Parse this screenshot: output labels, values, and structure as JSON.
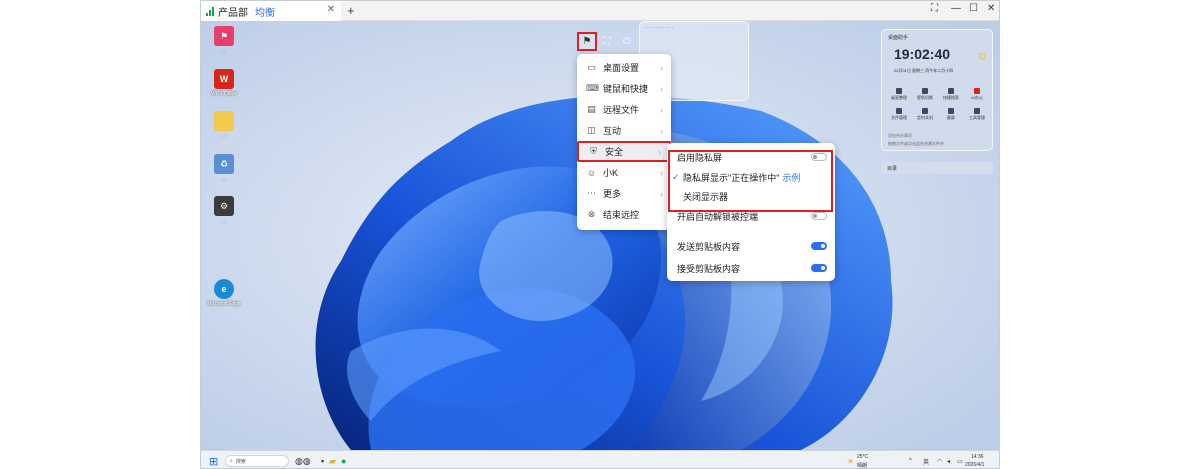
{
  "tab": {
    "host": "产品部",
    "mode": "均衡"
  },
  "remote_toolbar": {
    "items": [
      {
        "name": "tool-icon",
        "glyph": "⚑"
      },
      {
        "name": "fullscreen-icon",
        "glyph": "⛶"
      },
      {
        "name": "power-icon",
        "glyph": "⏻"
      }
    ]
  },
  "main_menu": {
    "items": [
      {
        "label": "桌面设置",
        "icon": "monitor-icon",
        "glyph": "▭"
      },
      {
        "label": "键鼠和快捷",
        "icon": "keyboard-icon",
        "glyph": "⌨"
      },
      {
        "label": "远程文件",
        "icon": "folder-icon",
        "glyph": "▤"
      },
      {
        "label": "互动",
        "icon": "interact-icon",
        "glyph": "◫"
      },
      {
        "label": "安全",
        "icon": "shield-icon",
        "glyph": "⛨",
        "selected": true
      },
      {
        "label": "小K",
        "icon": "robot-icon",
        "glyph": "☺"
      },
      {
        "label": "更多",
        "icon": "more-icon",
        "glyph": "⋯"
      },
      {
        "label": "结束远控",
        "icon": "stop-icon",
        "glyph": "⊗"
      }
    ]
  },
  "security_menu": {
    "privacy_screen_label": "启用隐私屏",
    "privacy_screen_on": false,
    "privacy_show_label": "隐私屏显示\"正在操作中\"",
    "privacy_show_checked": true,
    "example_link": "示例",
    "close_display_label": "关闭显示器",
    "auto_unlock_label": "开启自动解锁被控端",
    "auto_unlock_on": false,
    "send_clipboard_label": "发送剪贴板内容",
    "send_clipboard_on": true,
    "receive_clipboard_label": "接受剪贴板内容",
    "receive_clipboard_on": true
  },
  "desktop_icons": [
    {
      "label": "...",
      "color": "#e83e6b",
      "glyph": "⚑"
    },
    {
      "label": "WPS Office",
      "color": "#d9261c",
      "glyph": "W"
    },
    {
      "label": "...",
      "color": "#f3c94e",
      "glyph": ""
    },
    {
      "label": "...",
      "color": "#5a8fd6",
      "glyph": "♻"
    },
    {
      "label": "...",
      "color": "#3c3c3c",
      "glyph": "⚙"
    },
    {
      "label": "Microsoft Edge",
      "color": "#1a8ad6",
      "glyph": "e"
    }
  ],
  "widget": {
    "title": "桌面助手",
    "clock": "19:02:40",
    "date": "04月01日   星期三   丙午年二月十四",
    "row1": [
      "桌面整理",
      "壁纸切换",
      "快捷搜索",
      "AI办公"
    ],
    "row2": [
      "文件管理",
      "定时关机",
      "截屏",
      "工具管理"
    ],
    "done": "添加待办事项",
    "hint": "拖拽文件或点击此处创建文件夹",
    "dir_label": "目录"
  },
  "taskbar": {
    "search_placeholder": "搜索",
    "weather_temp": "25°C",
    "weather_desc": "晴朗",
    "ime": "英",
    "time": "14:36",
    "date": "2026/4/1"
  }
}
